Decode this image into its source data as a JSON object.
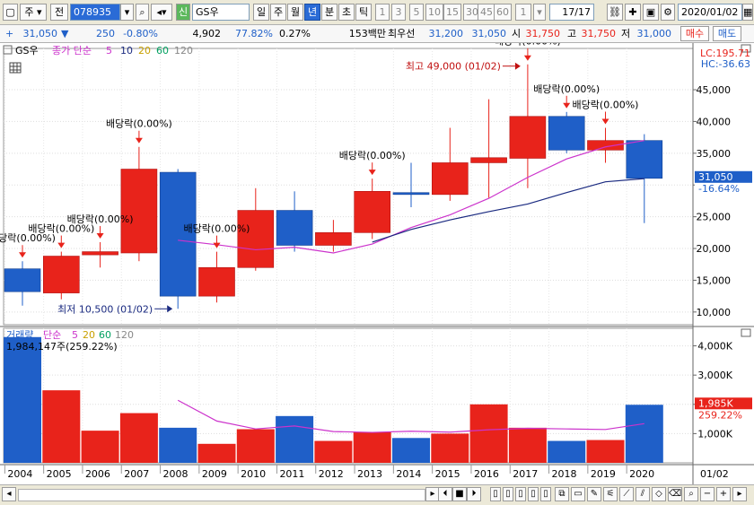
{
  "toolbar": {
    "type_label": "주",
    "prev_label": "전",
    "code_value": "078935",
    "sin_label": "신",
    "stock_name": "GS우",
    "periods": [
      {
        "label": "일",
        "selected": false
      },
      {
        "label": "주",
        "selected": false
      },
      {
        "label": "월",
        "selected": false
      },
      {
        "label": "년",
        "selected": true
      },
      {
        "label": "분",
        "selected": false
      },
      {
        "label": "초",
        "selected": false
      },
      {
        "label": "틱",
        "selected": false
      }
    ],
    "numbers": [
      "1",
      "3",
      "5",
      "10",
      "15",
      "30",
      "45",
      "60",
      "1"
    ],
    "count_value": "17",
    "count_total": "/17",
    "date_value": "2020/01/02"
  },
  "quote": {
    "price": "31,050",
    "change": "250",
    "change_pct": "-0.80%",
    "volume": "4,902",
    "pct2": "77.82%",
    "pct3": "0.27%",
    "amount": "153백만",
    "best_label": "최우선",
    "best_ask": "31,200",
    "best_bid": "31,050",
    "open_label": "시",
    "open": "31,750",
    "high_label": "고",
    "high": "31,750",
    "low_label": "저",
    "low": "31,000",
    "buy_label": "매수",
    "sell_label": "매도"
  },
  "chart": {
    "price_legend": {
      "name": "GS우",
      "ma_label": "종가 단순",
      "periods": [
        "5",
        "10",
        "20",
        "60",
        "120"
      ]
    },
    "volume_legend": {
      "name": "거래량",
      "ma_label": "단순",
      "periods": [
        "5",
        "20",
        "60",
        "120"
      ]
    },
    "volume_readout": "1,984,147주(259.22%)",
    "lc_label": "LC:195.71",
    "hc_label": "HC:-36.63",
    "current_price": "31,050",
    "current_pct": "-16.64%",
    "current_vol": "1,985K",
    "current_vol_pct": "259.22%",
    "date_readout": "01/02",
    "price_ticks": [
      "10,000",
      "15,000",
      "20,000",
      "25,000",
      "30,000",
      "35,000",
      "40,000",
      "45,000"
    ],
    "volume_ticks": [
      "1,000K",
      "2,000K",
      "3,000K",
      "4,000K"
    ],
    "dividend_label": "배당락(0.00%)",
    "max_label": "최고 49,000 (01/02)",
    "min_label": "최저 10,500 (01/02)",
    "colors": {
      "up": "#e8231b",
      "down": "#1f5fc8",
      "ma5": "#cc33cc",
      "ma10": "#1a2a80"
    }
  },
  "chart_data": {
    "type": "candlestick",
    "x": [
      "2004",
      "2005",
      "2006",
      "2007",
      "2008",
      "2009",
      "2010",
      "2011",
      "2012",
      "2013",
      "2014",
      "2015",
      "2016",
      "2017",
      "2018",
      "2019",
      "2020"
    ],
    "open": [
      16800,
      13000,
      19000,
      19300,
      32000,
      12500,
      17000,
      26000,
      20500,
      22500,
      28800,
      28500,
      33500,
      34200,
      40800,
      35500,
      37000
    ],
    "high": [
      18000,
      19500,
      21000,
      36000,
      32500,
      19500,
      29500,
      29000,
      24500,
      31000,
      33500,
      39000,
      43500,
      49000,
      41500,
      39000,
      38000
    ],
    "low": [
      11000,
      12000,
      17000,
      18000,
      10500,
      11500,
      16500,
      19500,
      19500,
      21500,
      26500,
      27500,
      28000,
      29500,
      35000,
      33500,
      24000
    ],
    "close": [
      13200,
      18800,
      19500,
      32500,
      12500,
      17000,
      26000,
      20500,
      22500,
      29000,
      28500,
      33500,
      34300,
      40800,
      35500,
      37000,
      31050
    ],
    "volume": [
      4300000,
      2480000,
      1100000,
      1700000,
      1200000,
      650000,
      1150000,
      1600000,
      750000,
      1050000,
      850000,
      1000000,
      2000000,
      1200000,
      750000,
      780000,
      1985000
    ],
    "ma5": [
      null,
      null,
      null,
      null,
      21300,
      20600,
      19800,
      20200,
      19300,
      20700,
      23300,
      25300,
      27900,
      31200,
      34100,
      36000,
      37000
    ],
    "ma10": [
      null,
      null,
      null,
      null,
      null,
      null,
      null,
      null,
      null,
      21000,
      23000,
      24500,
      25800,
      27000,
      28800,
      30500,
      31000
    ],
    "vol_ma5": [
      null,
      null,
      null,
      null,
      2140000,
      1430000,
      1160000,
      1260000,
      1070000,
      1040000,
      1080000,
      1050000,
      1130000,
      1180000,
      1160000,
      1140000,
      1340000
    ],
    "dividend_years": [
      "2004",
      "2005",
      "2006",
      "2007",
      "2009",
      "2013",
      "2017",
      "2018",
      "2019"
    ],
    "y_range": [
      8000,
      51500
    ],
    "volume_range": [
      0,
      4600000
    ]
  }
}
